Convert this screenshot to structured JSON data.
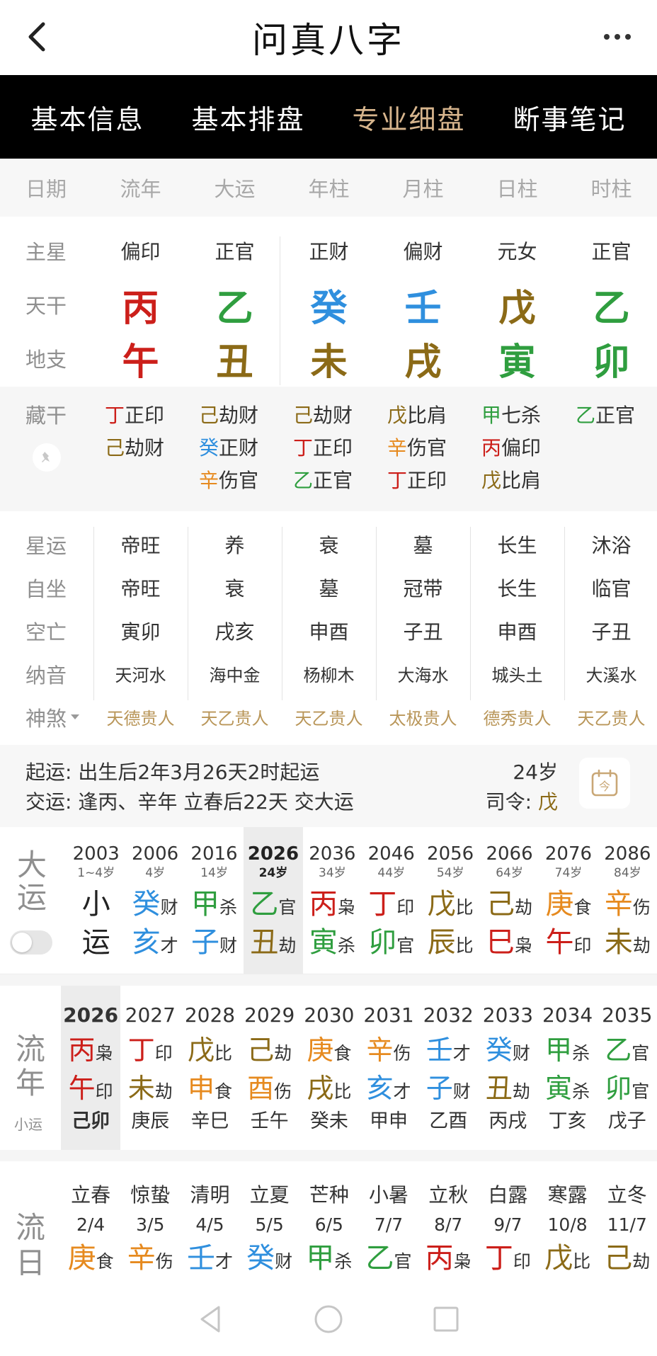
{
  "header": {
    "title": "问真八字"
  },
  "tabs": [
    {
      "label": "基本信息",
      "active": false
    },
    {
      "label": "基本排盘",
      "active": false
    },
    {
      "label": "专业细盘",
      "active": true
    },
    {
      "label": "断事笔记",
      "active": false
    }
  ],
  "colors": {
    "red": "#cc1f1a",
    "green": "#2f9e3f",
    "blue": "#2f8fde",
    "brown": "#8b6a17",
    "orange": "#e68a1f",
    "accent": "#d7b58d"
  },
  "columns": {
    "label": "日期",
    "items": [
      "流年",
      "大运",
      "年柱",
      "月柱",
      "日柱",
      "时柱"
    ]
  },
  "zhuxing": {
    "label": "主星",
    "values": [
      "偏印",
      "正官",
      "正财",
      "偏财",
      "元女",
      "正官"
    ]
  },
  "tiangan": {
    "label": "天干",
    "values": [
      {
        "c": "丙",
        "color": "red"
      },
      {
        "c": "乙",
        "color": "green"
      },
      {
        "c": "癸",
        "color": "blue"
      },
      {
        "c": "壬",
        "color": "blue"
      },
      {
        "c": "戊",
        "color": "brown"
      },
      {
        "c": "乙",
        "color": "green"
      }
    ]
  },
  "dizhi": {
    "label": "地支",
    "values": [
      {
        "c": "午",
        "color": "red"
      },
      {
        "c": "丑",
        "color": "brown"
      },
      {
        "c": "未",
        "color": "brown"
      },
      {
        "c": "戌",
        "color": "brown"
      },
      {
        "c": "寅",
        "color": "green"
      },
      {
        "c": "卯",
        "color": "green"
      }
    ]
  },
  "canggan": {
    "label": "藏干",
    "cols": [
      [
        {
          "g": "丁",
          "color": "red",
          "s": "正印"
        },
        {
          "g": "己",
          "color": "brown",
          "s": "劫财"
        }
      ],
      [
        {
          "g": "己",
          "color": "brown",
          "s": "劫财"
        },
        {
          "g": "癸",
          "color": "blue",
          "s": "正财"
        },
        {
          "g": "辛",
          "color": "orange",
          "s": "伤官"
        }
      ],
      [
        {
          "g": "己",
          "color": "brown",
          "s": "劫财"
        },
        {
          "g": "丁",
          "color": "red",
          "s": "正印"
        },
        {
          "g": "乙",
          "color": "green",
          "s": "正官"
        }
      ],
      [
        {
          "g": "戊",
          "color": "brown",
          "s": "比肩"
        },
        {
          "g": "辛",
          "color": "orange",
          "s": "伤官"
        },
        {
          "g": "丁",
          "color": "red",
          "s": "正印"
        }
      ],
      [
        {
          "g": "甲",
          "color": "green",
          "s": "七杀"
        },
        {
          "g": "丙",
          "color": "red",
          "s": "偏印"
        },
        {
          "g": "戊",
          "color": "brown",
          "s": "比肩"
        }
      ],
      [
        {
          "g": "乙",
          "color": "green",
          "s": "正官"
        }
      ]
    ]
  },
  "xingyun": {
    "label": "星运",
    "values": [
      "帝旺",
      "养",
      "衰",
      "墓",
      "长生",
      "沐浴"
    ]
  },
  "zizuo": {
    "label": "自坐",
    "values": [
      "帝旺",
      "衰",
      "墓",
      "冠带",
      "长生",
      "临官"
    ]
  },
  "kongwang": {
    "label": "空亡",
    "values": [
      "寅卯",
      "戌亥",
      "申酉",
      "子丑",
      "申酉",
      "子丑"
    ]
  },
  "nayin": {
    "label": "纳音",
    "values": [
      "天河水",
      "海中金",
      "杨柳木",
      "大海水",
      "城头土",
      "大溪水"
    ]
  },
  "shensha": {
    "label": "神煞",
    "values": [
      "天德贵人",
      "天乙贵人",
      "天乙贵人",
      "太极贵人",
      "德秀贵人",
      "天乙贵人"
    ]
  },
  "qiyun": {
    "l1_label": "起运:",
    "l1_value": "出生后2年3月26天2时起运",
    "age": "24岁",
    "l2_label": "交运:",
    "l2_value": "逢丙、辛年 立春后22天 交大运",
    "siling_label": "司令:",
    "siling_value": "戊"
  },
  "dayun": {
    "title1": "大",
    "title2": "运",
    "items": [
      {
        "year": "2003",
        "age": "1~4岁",
        "g1": "小",
        "g1c": "dark",
        "s1": "",
        "g2": "运",
        "g2c": "dark",
        "s2": "",
        "current": false
      },
      {
        "year": "2006",
        "age": "4岁",
        "g1": "癸",
        "g1c": "blue",
        "s1": "财",
        "g2": "亥",
        "g2c": "blue",
        "s2": "才",
        "current": false
      },
      {
        "year": "2016",
        "age": "14岁",
        "g1": "甲",
        "g1c": "green",
        "s1": "杀",
        "g2": "子",
        "g2c": "blue",
        "s2": "财",
        "current": false
      },
      {
        "year": "2026",
        "age": "24岁",
        "g1": "乙",
        "g1c": "green",
        "s1": "官",
        "g2": "丑",
        "g2c": "brown",
        "s2": "劫",
        "current": true
      },
      {
        "year": "2036",
        "age": "34岁",
        "g1": "丙",
        "g1c": "red",
        "s1": "枭",
        "g2": "寅",
        "g2c": "green",
        "s2": "杀",
        "current": false
      },
      {
        "year": "2046",
        "age": "44岁",
        "g1": "丁",
        "g1c": "red",
        "s1": "印",
        "g2": "卯",
        "g2c": "green",
        "s2": "官",
        "current": false
      },
      {
        "year": "2056",
        "age": "54岁",
        "g1": "戊",
        "g1c": "brown",
        "s1": "比",
        "g2": "辰",
        "g2c": "brown",
        "s2": "比",
        "current": false
      },
      {
        "year": "2066",
        "age": "64岁",
        "g1": "己",
        "g1c": "brown",
        "s1": "劫",
        "g2": "巳",
        "g2c": "red",
        "s2": "枭",
        "current": false
      },
      {
        "year": "2076",
        "age": "74岁",
        "g1": "庚",
        "g1c": "orange",
        "s1": "食",
        "g2": "午",
        "g2c": "red",
        "s2": "印",
        "current": false
      },
      {
        "year": "2086",
        "age": "84岁",
        "g1": "辛",
        "g1c": "orange",
        "s1": "伤",
        "g2": "未",
        "g2c": "brown",
        "s2": "劫",
        "current": false
      }
    ]
  },
  "liunian": {
    "title1": "流",
    "title2": "年",
    "sub": "小运",
    "items": [
      {
        "year": "2026",
        "g1": "丙",
        "g1c": "red",
        "s1": "枭",
        "g2": "午",
        "g2c": "red",
        "s2": "印",
        "xy": "己卯",
        "current": true
      },
      {
        "year": "2027",
        "g1": "丁",
        "g1c": "red",
        "s1": "印",
        "g2": "未",
        "g2c": "brown",
        "s2": "劫",
        "xy": "庚辰",
        "current": false
      },
      {
        "year": "2028",
        "g1": "戊",
        "g1c": "brown",
        "s1": "比",
        "g2": "申",
        "g2c": "orange",
        "s2": "食",
        "xy": "辛巳",
        "current": false
      },
      {
        "year": "2029",
        "g1": "己",
        "g1c": "brown",
        "s1": "劫",
        "g2": "酉",
        "g2c": "orange",
        "s2": "伤",
        "xy": "壬午",
        "current": false
      },
      {
        "year": "2030",
        "g1": "庚",
        "g1c": "orange",
        "s1": "食",
        "g2": "戌",
        "g2c": "brown",
        "s2": "比",
        "xy": "癸未",
        "current": false
      },
      {
        "year": "2031",
        "g1": "辛",
        "g1c": "orange",
        "s1": "伤",
        "g2": "亥",
        "g2c": "blue",
        "s2": "才",
        "xy": "甲申",
        "current": false
      },
      {
        "year": "2032",
        "g1": "壬",
        "g1c": "blue",
        "s1": "才",
        "g2": "子",
        "g2c": "blue",
        "s2": "财",
        "xy": "乙酉",
        "current": false
      },
      {
        "year": "2033",
        "g1": "癸",
        "g1c": "blue",
        "s1": "财",
        "g2": "丑",
        "g2c": "brown",
        "s2": "劫",
        "xy": "丙戌",
        "current": false
      },
      {
        "year": "2034",
        "g1": "甲",
        "g1c": "green",
        "s1": "杀",
        "g2": "寅",
        "g2c": "green",
        "s2": "杀",
        "xy": "丁亥",
        "current": false
      },
      {
        "year": "2035",
        "g1": "乙",
        "g1c": "green",
        "s1": "官",
        "g2": "卯",
        "g2c": "green",
        "s2": "官",
        "xy": "戊子",
        "current": false
      }
    ]
  },
  "liuyue": {
    "title1": "流",
    "title2": "日",
    "items": [
      {
        "jq": "立春",
        "date": "2/4",
        "g1": "庚",
        "g1c": "orange",
        "s1": "食"
      },
      {
        "jq": "惊蛰",
        "date": "3/5",
        "g1": "辛",
        "g1c": "orange",
        "s1": "伤"
      },
      {
        "jq": "清明",
        "date": "4/5",
        "g1": "壬",
        "g1c": "blue",
        "s1": "才"
      },
      {
        "jq": "立夏",
        "date": "5/5",
        "g1": "癸",
        "g1c": "blue",
        "s1": "财"
      },
      {
        "jq": "芒种",
        "date": "6/5",
        "g1": "甲",
        "g1c": "green",
        "s1": "杀"
      },
      {
        "jq": "小暑",
        "date": "7/7",
        "g1": "乙",
        "g1c": "green",
        "s1": "官"
      },
      {
        "jq": "立秋",
        "date": "8/7",
        "g1": "丙",
        "g1c": "red",
        "s1": "枭"
      },
      {
        "jq": "白露",
        "date": "9/7",
        "g1": "丁",
        "g1c": "red",
        "s1": "印"
      },
      {
        "jq": "寒露",
        "date": "10/8",
        "g1": "戊",
        "g1c": "brown",
        "s1": "比"
      },
      {
        "jq": "立冬",
        "date": "11/7",
        "g1": "己",
        "g1c": "brown",
        "s1": "劫"
      }
    ]
  }
}
